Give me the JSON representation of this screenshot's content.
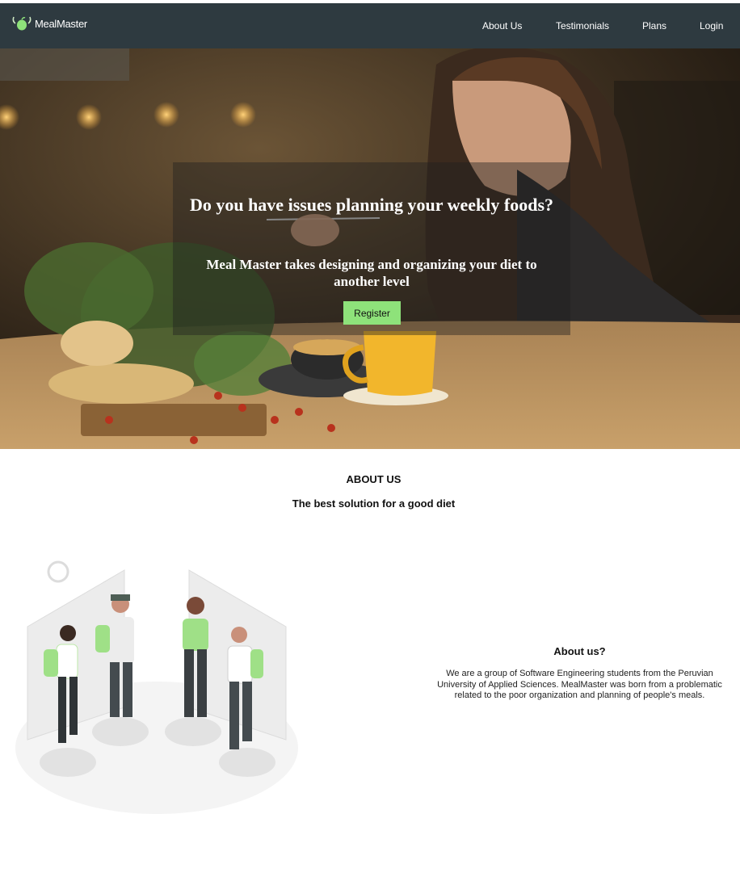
{
  "brand": {
    "name": "MealMaster",
    "accent": "#8ee27a",
    "nav_bg": "#2e3a40"
  },
  "nav": {
    "about": "About Us",
    "testimonials": "Testimonials",
    "plans": "Plans",
    "login": "Login"
  },
  "hero": {
    "title": "Do you have issues planning your weekly foods?",
    "subtitle": "Meal Master takes designing and organizing your diet to another level",
    "register_label": "Register"
  },
  "about": {
    "heading": "ABOUT US",
    "tagline": "The best solution for a good diet",
    "question": "About us?",
    "body": "We are a group of Software Engineering students from the Peruvian University of Applied Sciences. MealMaster was born from a problematic related to the poor organization and planning of people's meals."
  }
}
